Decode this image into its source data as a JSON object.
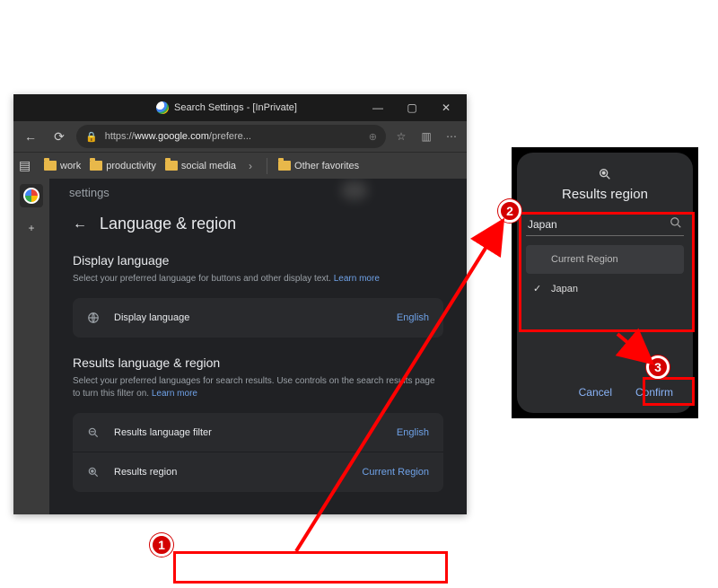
{
  "window": {
    "title": "Search Settings - [InPrivate]",
    "url_prefix": "https://",
    "url_bold": "www.google.com",
    "url_suffix": "/prefere..."
  },
  "bookmarks": {
    "items": [
      "work",
      "productivity",
      "social media"
    ],
    "other": "Other favorites"
  },
  "settings_label": "settings",
  "page": {
    "title": "Language & region",
    "section1_h": "Display language",
    "section1_desc": "Select your preferred language for buttons and other display text.",
    "learn_more": "Learn more",
    "card_display_language_label": "Display language",
    "card_display_language_value": "English",
    "section2_h": "Results language & region",
    "section2_desc": "Select your preferred languages for search results. Use controls on the search results page to turn this filter on.",
    "card_results_lang_label": "Results language filter",
    "card_results_lang_value": "English",
    "card_results_region_label": "Results region",
    "card_results_region_value": "Current Region"
  },
  "dialog": {
    "title": "Results region",
    "search_value": "Japan",
    "current_region_label": "Current Region",
    "option_selected": "Japan",
    "cancel": "Cancel",
    "confirm": "Confirm"
  },
  "annotations": {
    "badge1": "1",
    "badge2": "2",
    "badge3": "3"
  }
}
